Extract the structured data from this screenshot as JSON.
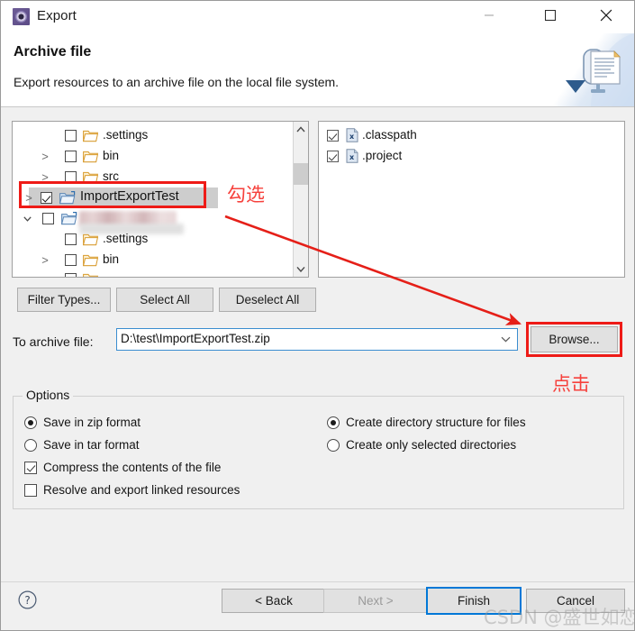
{
  "window": {
    "title": "Export",
    "icon": "export-gear-icon",
    "controls": {
      "minimize": "minimize-icon",
      "maximize": "maximize-icon",
      "close": "close-icon"
    }
  },
  "header": {
    "title": "Archive file",
    "description": "Export resources to an archive file on the local file system.",
    "banner_icon": "archive-export-banner-icon"
  },
  "left_tree": {
    "rows": [
      {
        "label": ".settings",
        "indent": 2,
        "checked": false,
        "twisty": "",
        "icon": "folder-icon",
        "selected": false,
        "blurred": false
      },
      {
        "label": "bin",
        "indent": 2,
        "checked": false,
        "twisty": ">",
        "icon": "folder-icon",
        "selected": false,
        "blurred": false
      },
      {
        "label": "src",
        "indent": 2,
        "checked": false,
        "twisty": ">",
        "icon": "folder-icon",
        "selected": false,
        "blurred": false
      },
      {
        "label": "ImportExportTest",
        "indent": 1,
        "checked": true,
        "twisty": ">",
        "icon": "project-folder-icon",
        "selected": true,
        "blurred": false
      },
      {
        "label": "",
        "indent": 1,
        "checked": false,
        "twisty": "v",
        "icon": "project-folder-icon",
        "selected": false,
        "blurred": true
      },
      {
        "label": ".settings",
        "indent": 2,
        "checked": false,
        "twisty": "",
        "icon": "folder-icon",
        "selected": false,
        "blurred": false
      },
      {
        "label": "bin",
        "indent": 2,
        "checked": false,
        "twisty": ">",
        "icon": "folder-icon",
        "selected": false,
        "blurred": false
      },
      {
        "label": "",
        "indent": 2,
        "checked": false,
        "twisty": "",
        "icon": "folder-icon",
        "selected": false,
        "blurred": true
      }
    ],
    "scrollbar": {
      "up": "scroll-up-arrow",
      "down": "scroll-down-arrow"
    }
  },
  "right_tree": {
    "rows": [
      {
        "label": ".classpath",
        "checked": true,
        "icon": "xml-file-icon"
      },
      {
        "label": ".project",
        "checked": true,
        "icon": "xml-file-icon"
      }
    ]
  },
  "tree_buttons": {
    "filter_types": "Filter Types...",
    "select_all": "Select All",
    "deselect_all": "Deselect All"
  },
  "archive": {
    "label": "To archive file:",
    "value": "D:\\test\\ImportExportTest.zip",
    "placeholder": "",
    "dropdown_icon": "chevron-down-icon",
    "browse_button": "Browse..."
  },
  "options": {
    "legend": "Options",
    "left_column": [
      {
        "type": "radio",
        "label": "Save in zip format",
        "selected": true
      },
      {
        "type": "radio",
        "label": "Save in tar format",
        "selected": false
      },
      {
        "type": "checkbox",
        "label": "Compress the contents of the file",
        "selected": true
      },
      {
        "type": "checkbox",
        "label": "Resolve and export linked resources",
        "selected": false
      }
    ],
    "right_column": [
      {
        "type": "radio",
        "label": "Create directory structure for files",
        "selected": true
      },
      {
        "type": "radio",
        "label": "Create only selected directories",
        "selected": false
      }
    ]
  },
  "footer": {
    "help_icon": "help-question-icon",
    "back": "< Back",
    "next": "Next >",
    "finish": "Finish",
    "cancel": "Cancel",
    "next_enabled": false,
    "finish_default": true
  },
  "annotations": {
    "check_note": "勾选",
    "click_note": "点击",
    "arrow": "red-arrow-pointer",
    "highlight_tree": "red-highlight-box",
    "highlight_browse": "red-highlight-box"
  },
  "watermark": {
    "text": "CSDN @盛世如恋"
  },
  "colors": {
    "annotation_red": "#f6413c",
    "highlight_red": "#ee1b17",
    "focus_blue": "#0078d7",
    "selection_gray": "#cdcdcd"
  }
}
